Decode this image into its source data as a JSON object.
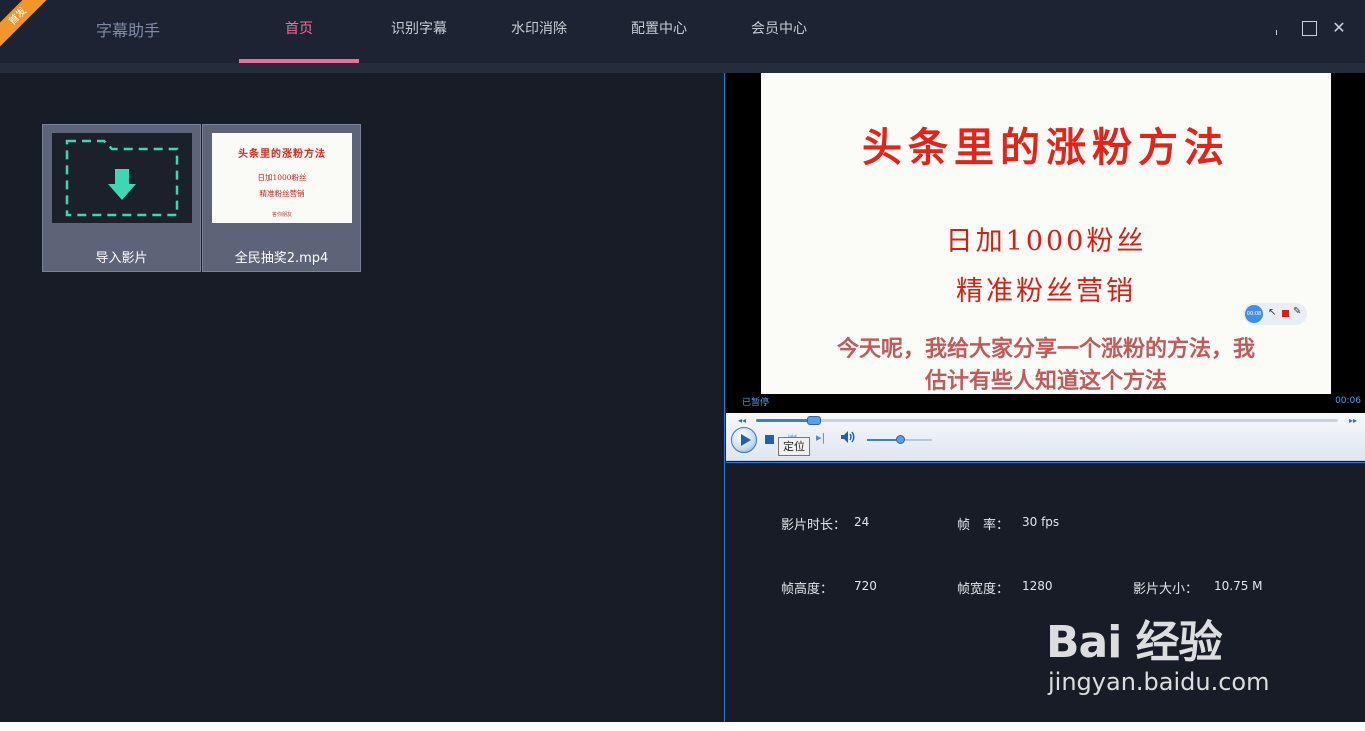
{
  "titlebar": {
    "badge": "首发",
    "app_title": "字幕助手",
    "tabs": [
      {
        "label": "首页",
        "active": true
      },
      {
        "label": "识别字幕",
        "active": false
      },
      {
        "label": "水印消除",
        "active": false
      },
      {
        "label": "配置中心",
        "active": false
      },
      {
        "label": "会员中心",
        "active": false
      }
    ],
    "window_buttons": {
      "close": "✕"
    }
  },
  "library": {
    "items": [
      {
        "label": "导入影片",
        "type": "import"
      },
      {
        "label": "全民抽奖2.mp4",
        "type": "video",
        "thumb_title": "头条里的涨粉方法",
        "thumb_line1": "日加1000粉丝",
        "thumb_line2": "精准粉丝营销",
        "thumb_line3": "答你朋友"
      }
    ]
  },
  "player": {
    "frame": {
      "title": "头条里的涨粉方法",
      "line1": "日加1000粉丝",
      "line2": "精准粉丝营销",
      "subtitle1": "今天呢，我给大家分享一个涨粉的方法，我",
      "subtitle2": "估计有些人知道这个方法",
      "rec_time": "00:08"
    },
    "status": "已暂停",
    "time": "00:06",
    "seek_progress": 0.1,
    "volume_level": 0.5,
    "tooltip": "定位",
    "icons": {
      "seek_back": "◂◂",
      "seek_fwd": "▸▸",
      "prev": "⏮",
      "next": "▸|",
      "volume": "🔊"
    }
  },
  "info": {
    "duration_label": "影片时长：",
    "duration_value": "24",
    "fps_label": "帧　率：",
    "fps_value": "30 fps",
    "height_label": "帧高度：",
    "height_value": "720",
    "width_label": "帧宽度：",
    "width_value": "1280",
    "size_label": "影片大小：",
    "size_value": "10.75 M"
  },
  "watermark": {
    "main": "Bai 经验",
    "sub": "jingyan.baidu.com"
  }
}
